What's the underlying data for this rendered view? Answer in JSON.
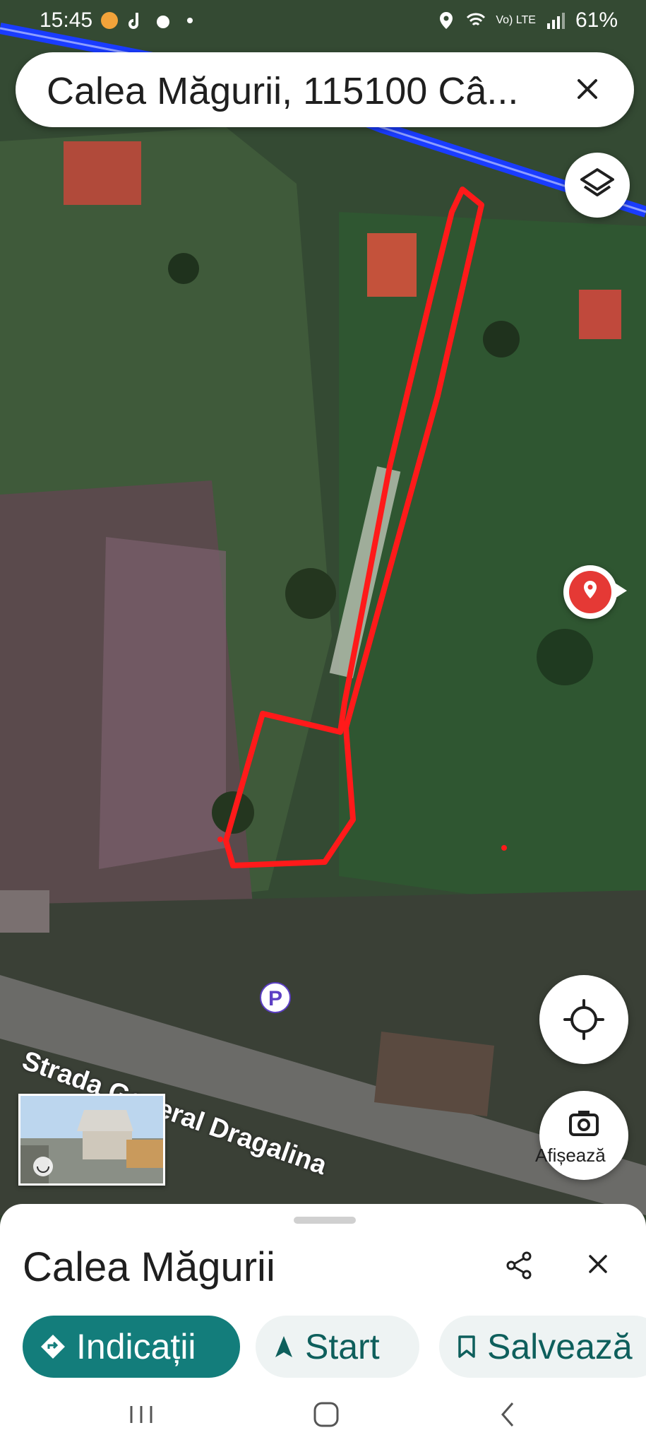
{
  "status_bar": {
    "time": "15:45",
    "signal_label": "Vo) LTE",
    "battery": "61%"
  },
  "search": {
    "query": "Calea Măgurii, 115100 Câ..."
  },
  "map": {
    "street_label": "Strada General Dragalina",
    "parking_label": "P",
    "outline_color": "#ff1a1a",
    "road_color": "#1a3cff"
  },
  "controls": {
    "streetview_label": "Afișează"
  },
  "sheet": {
    "place_name": "Calea Măgurii",
    "directions_label": "Indicații",
    "start_label": "Start",
    "save_label": "Salvează"
  },
  "icons": [
    "layers-icon",
    "location-pin-icon",
    "my-location-icon",
    "camera-icon",
    "share-icon",
    "close-icon",
    "directions-icon",
    "navigation-arrow-icon",
    "bookmark-icon",
    "recent-apps-icon",
    "home-icon",
    "back-icon",
    "wifi-icon",
    "signal-icon",
    "location-status-icon"
  ]
}
